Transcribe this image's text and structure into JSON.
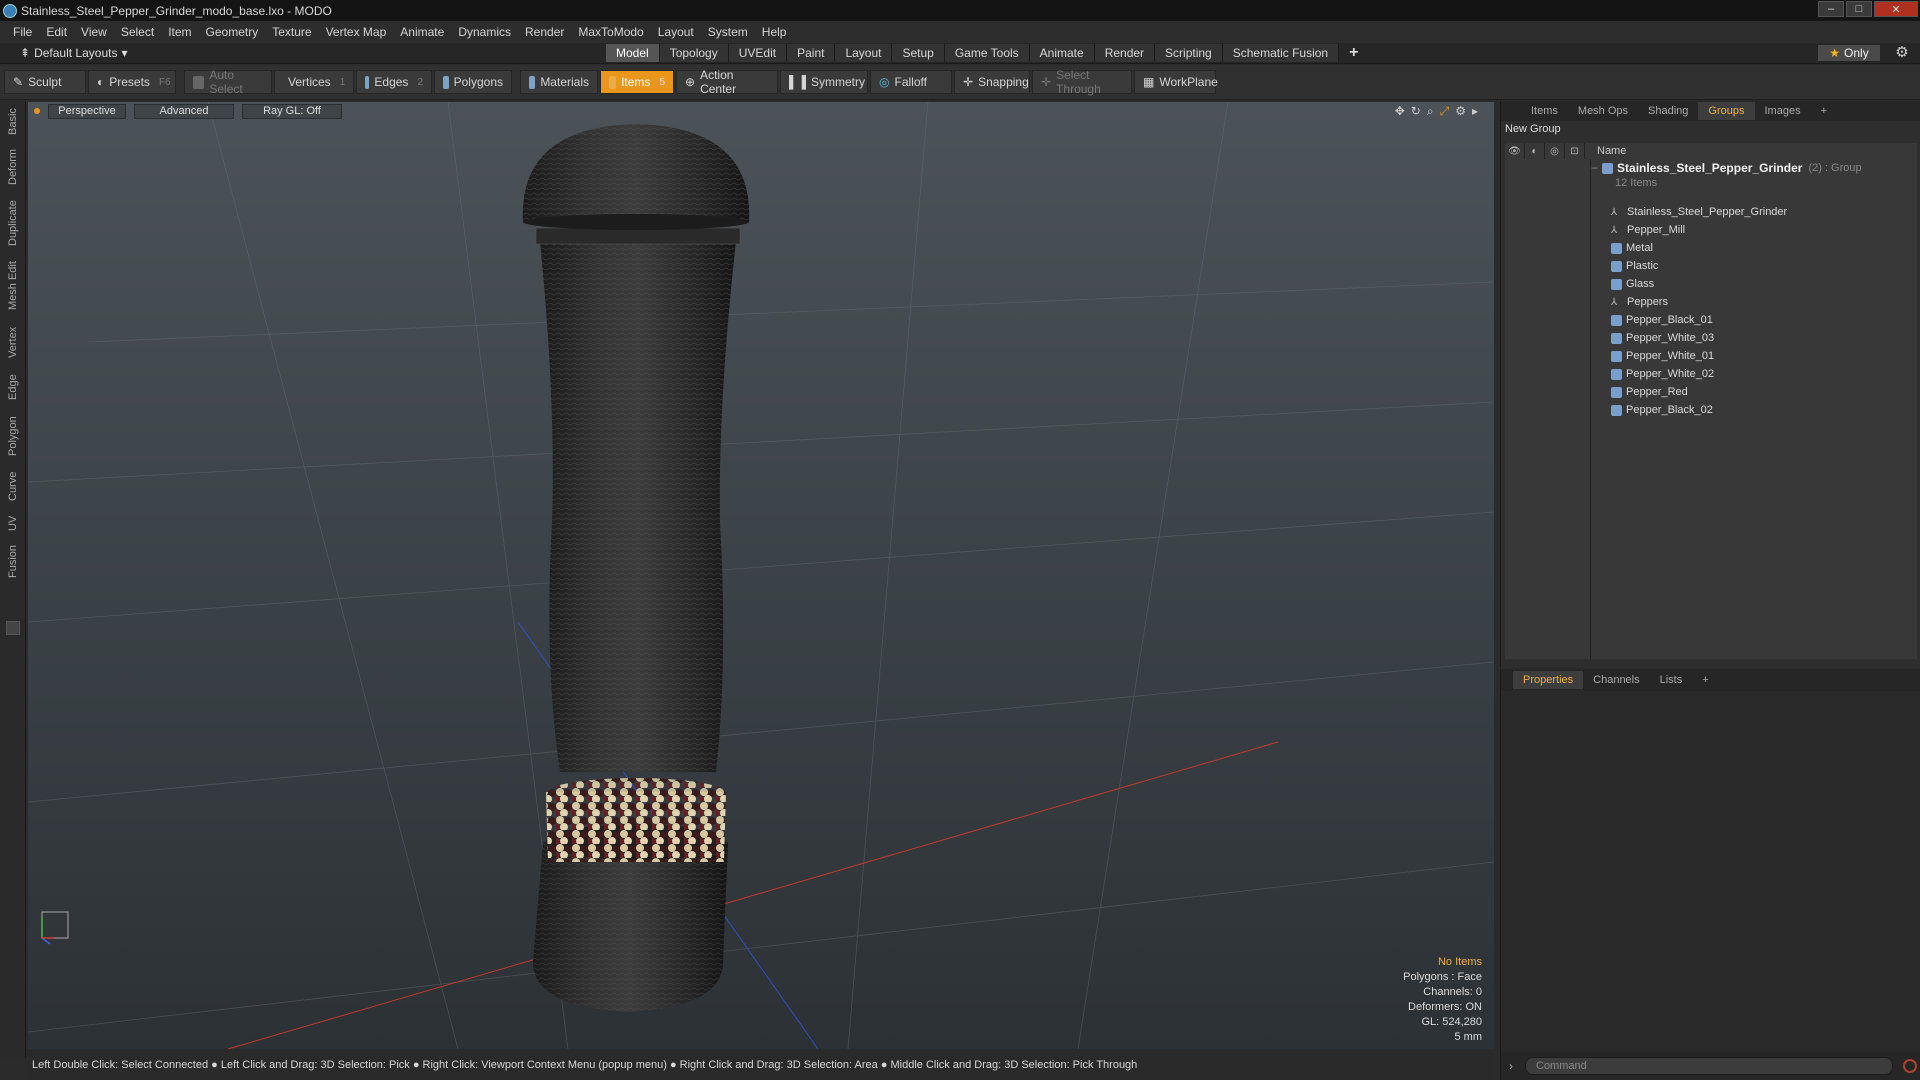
{
  "window": {
    "title": "Stainless_Steel_Pepper_Grinder_modo_base.lxo - MODO"
  },
  "menu": [
    "File",
    "Edit",
    "View",
    "Select",
    "Item",
    "Geometry",
    "Texture",
    "Vertex Map",
    "Animate",
    "Dynamics",
    "Render",
    "MaxToModo",
    "Layout",
    "System",
    "Help"
  ],
  "layout": {
    "default_layouts": "Default Layouts",
    "tabs": [
      "Model",
      "Topology",
      "UVEdit",
      "Paint",
      "Layout",
      "Setup",
      "Game Tools",
      "Animate",
      "Render",
      "Scripting",
      "Schematic Fusion"
    ],
    "active_tab": "Model",
    "only_label": "Only"
  },
  "toolbar": {
    "sculpt": "Sculpt",
    "presets": "Presets",
    "presets_key": "F6",
    "auto_select": "Auto Select",
    "vertices": "Vertices",
    "vertices_key": "1",
    "edges": "Edges",
    "edges_key": "2",
    "polygons": "Polygons",
    "materials": "Materials",
    "items": "Items",
    "items_key": "5",
    "action_center": "Action Center",
    "symmetry": "Symmetry",
    "falloff": "Falloff",
    "snapping": "Snapping",
    "select_through": "Select Through",
    "workplane": "WorkPlane"
  },
  "left_tabs": [
    "Basic",
    "Deform",
    "Duplicate",
    "Mesh Edit",
    "Vertex",
    "Edge",
    "Polygon",
    "Curve",
    "UV",
    "Fusion"
  ],
  "viewport": {
    "view": "Perspective",
    "shading": "Advanced",
    "raygl": "Ray GL: Off",
    "hud": {
      "no_items": "No Items",
      "polygons": "Polygons : Face",
      "channels": "Channels: 0",
      "deformers": "Deformers: ON",
      "gl": "GL: 524,280",
      "scale": "5 mm"
    }
  },
  "statusbar": "Left Double Click: Select Connected ● Left Click and Drag: 3D Selection: Pick ● Right Click: Viewport Context Menu (popup menu) ● Right Click and Drag: 3D Selection: Area ● Middle Click and Drag: 3D Selection: Pick Through",
  "right_panel": {
    "tabs": [
      "Items",
      "Mesh Ops",
      "Shading",
      "Groups",
      "Images"
    ],
    "active_tab": "Groups",
    "new_group": "New Group",
    "name_header": "Name",
    "group": {
      "name": "Stainless_Steel_Pepper_Grinder",
      "count": "(2) : Group",
      "items": "12 Items"
    },
    "items": [
      {
        "label": "Stainless_Steel_Pepper_Grinder",
        "icon": "locator-icon"
      },
      {
        "label": "Pepper_Mill",
        "icon": "locator-icon"
      },
      {
        "label": "Metal",
        "icon": "mesh-icon"
      },
      {
        "label": "Plastic",
        "icon": "mesh-icon"
      },
      {
        "label": "Glass",
        "icon": "mesh-icon"
      },
      {
        "label": "Peppers",
        "icon": "locator-icon"
      },
      {
        "label": "Pepper_Black_01",
        "icon": "mesh-icon"
      },
      {
        "label": "Pepper_White_03",
        "icon": "mesh-icon"
      },
      {
        "label": "Pepper_White_01",
        "icon": "mesh-icon"
      },
      {
        "label": "Pepper_White_02",
        "icon": "mesh-icon"
      },
      {
        "label": "Pepper_Red",
        "icon": "mesh-icon"
      },
      {
        "label": "Pepper_Black_02",
        "icon": "mesh-icon"
      }
    ]
  },
  "bottom_panel": {
    "tabs": [
      "Properties",
      "Channels",
      "Lists"
    ],
    "active_tab": "Properties",
    "command_placeholder": "Command"
  },
  "colors": {
    "accent": "#e8961c",
    "highlight_text": "#f0b040"
  }
}
